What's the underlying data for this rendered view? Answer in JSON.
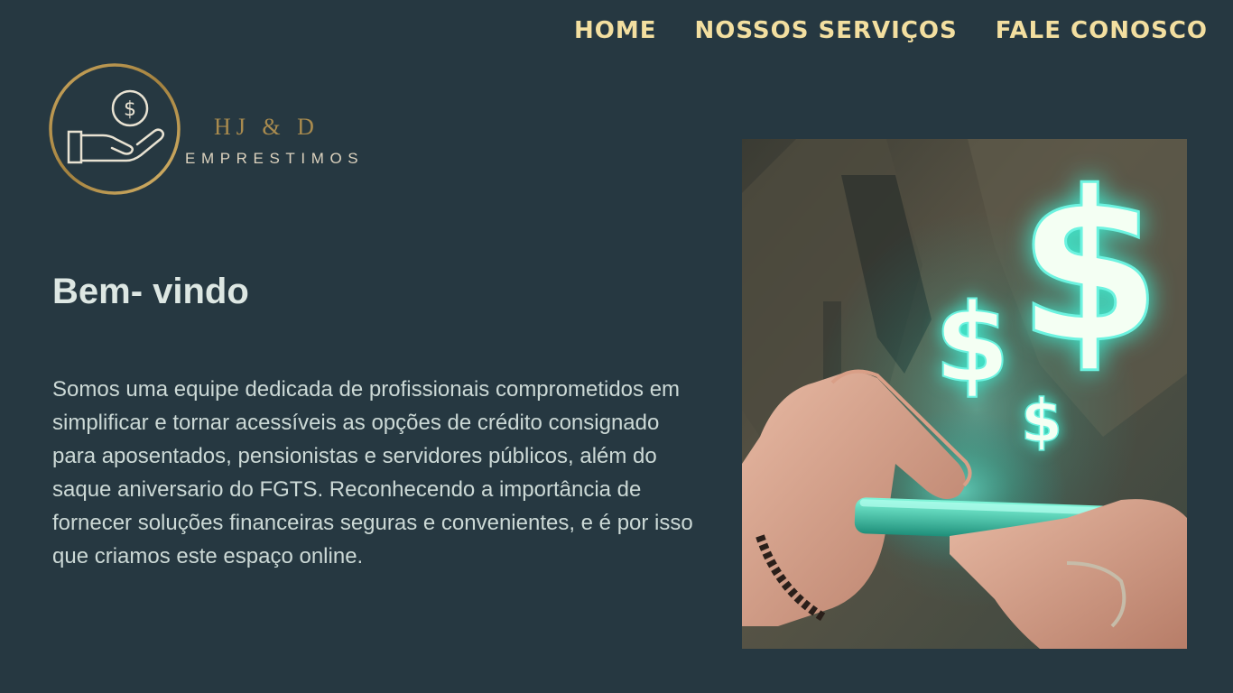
{
  "nav": {
    "items": [
      {
        "label": "HOME"
      },
      {
        "label": "NOSSOS SERVIÇOS"
      },
      {
        "label": "FALE CONOSCO"
      }
    ]
  },
  "logo": {
    "title": "HJ & D",
    "subtitle": "EMPRESTIMOS"
  },
  "hero": {
    "heading": "Bem- vindo",
    "paragraph": "Somos uma equipe dedicada de profissionais comprometidos em simplificar e tornar acessíveis as opções de crédito consignado para aposentados, pensionistas e servidores públicos, além do saque aniversario do FGTS. Reconhecendo a importância de fornecer soluções financeiras seguras e convenientes, e é por isso que criamos este espaço online."
  },
  "image": {
    "symbols": [
      "$",
      "$",
      "$"
    ]
  },
  "colors": {
    "background": "#263841",
    "nav_text": "#f3dfa0",
    "gold": "#a98b4e",
    "glow": "#3ef2d6"
  }
}
